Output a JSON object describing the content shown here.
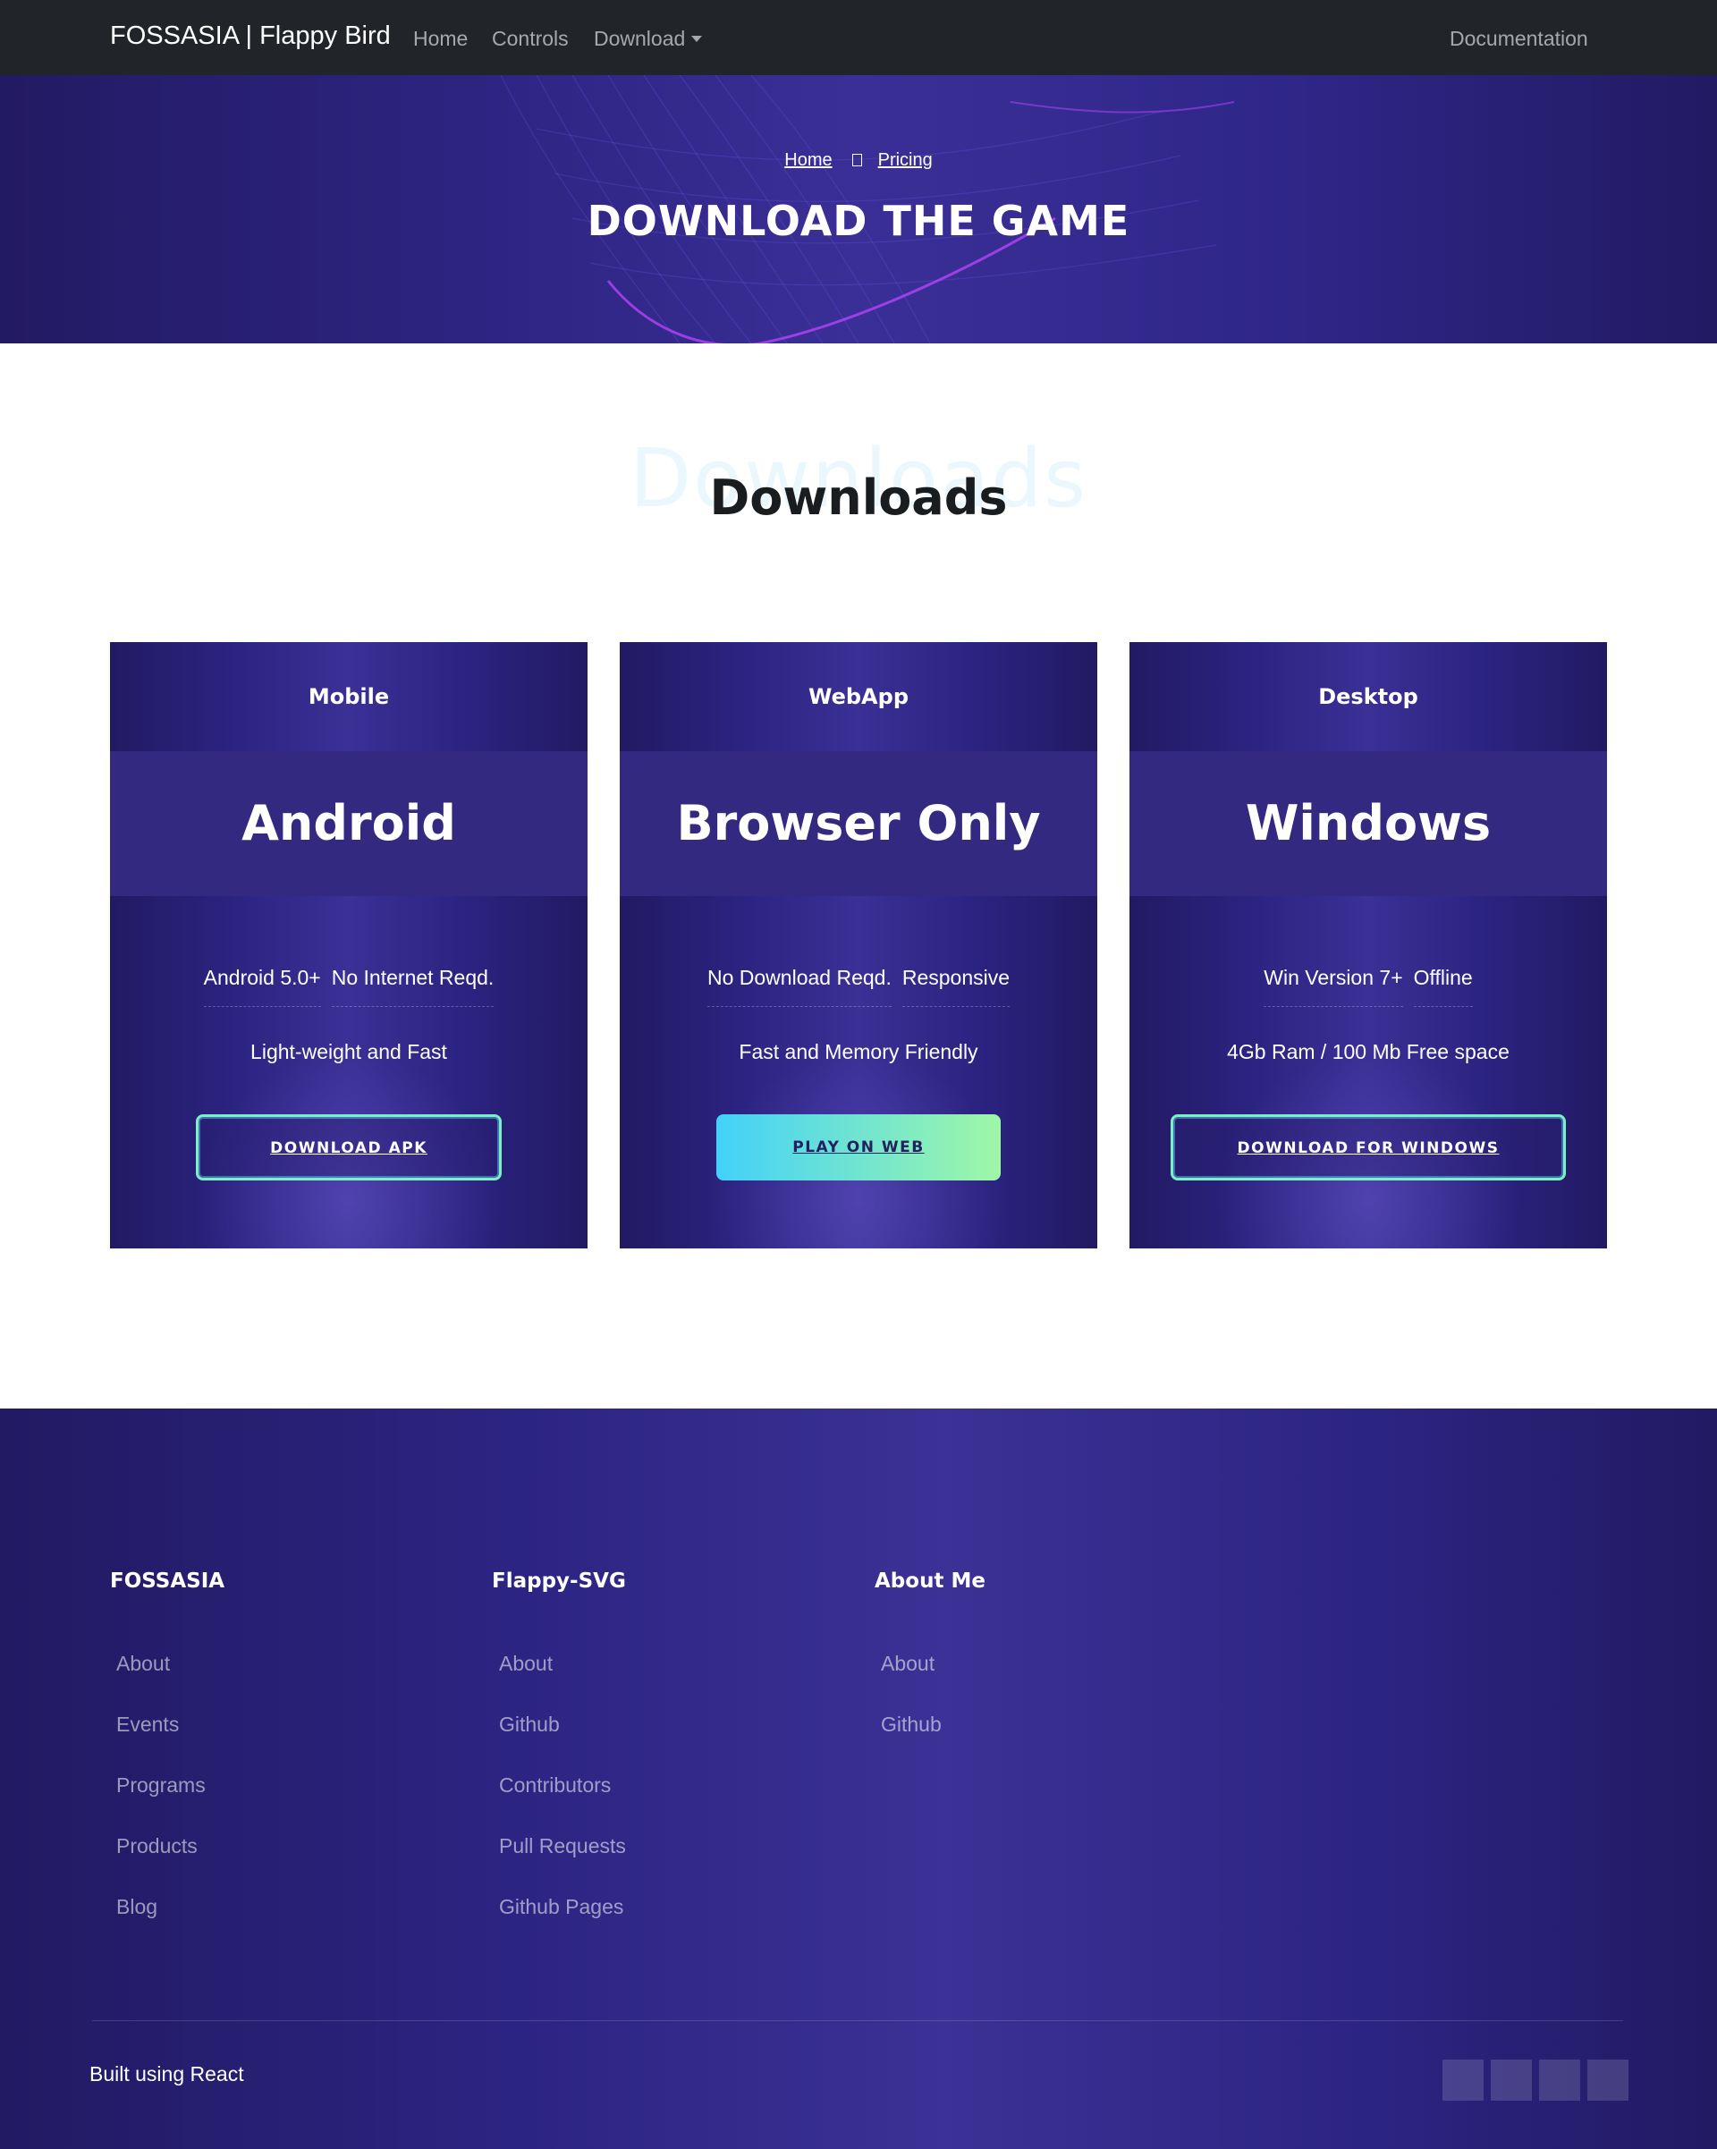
{
  "navbar": {
    "brand": "FOSSASIA | Flappy Bird",
    "links": [
      {
        "label": "Home"
      },
      {
        "label": "Controls"
      },
      {
        "label": "Download"
      }
    ],
    "docs": "Documentation"
  },
  "hero": {
    "breadcrumb": {
      "home": "Home",
      "current": "Pricing"
    },
    "title": "DOWNLOAD THE GAME"
  },
  "section": {
    "ghost_title": "Downloads",
    "title": "Downloads"
  },
  "cards": [
    {
      "category": "Mobile",
      "name": "Android",
      "features": [
        "Android 5.0+",
        "No Internet Reqd."
      ],
      "line": "Light-weight and Fast",
      "button": "DOWNLOAD APK"
    },
    {
      "category": "WebApp",
      "name": "Browser Only",
      "features": [
        "No Download Reqd.",
        "Responsive"
      ],
      "line": "Fast and Memory Friendly",
      "button": "PLAY ON WEB"
    },
    {
      "category": "Desktop",
      "name": "Windows",
      "features": [
        "Win Version 7+",
        "Offline"
      ],
      "line": "4Gb Ram / 100 Mb Free space",
      "button": "DOWNLOAD FOR WINDOWS"
    }
  ],
  "footer": {
    "columns": [
      {
        "heading": "FOSSASIA",
        "links": [
          "About",
          "Events",
          "Programs",
          "Products",
          "Blog"
        ]
      },
      {
        "heading": "Flappy-SVG",
        "links": [
          "About",
          "Github",
          "Contributors",
          "Pull Requests",
          "Github Pages"
        ]
      },
      {
        "heading": "About Me",
        "links": [
          "About",
          "Github"
        ]
      }
    ],
    "built": "Built using React"
  },
  "colors": {
    "navbar_bg": "#212529",
    "hero_bg": "#2e2584",
    "card_band": "#332980",
    "button_outline": "#7bf0c4",
    "button_gradient_start": "#42d1fa",
    "button_gradient_end": "#9ff7a7"
  }
}
